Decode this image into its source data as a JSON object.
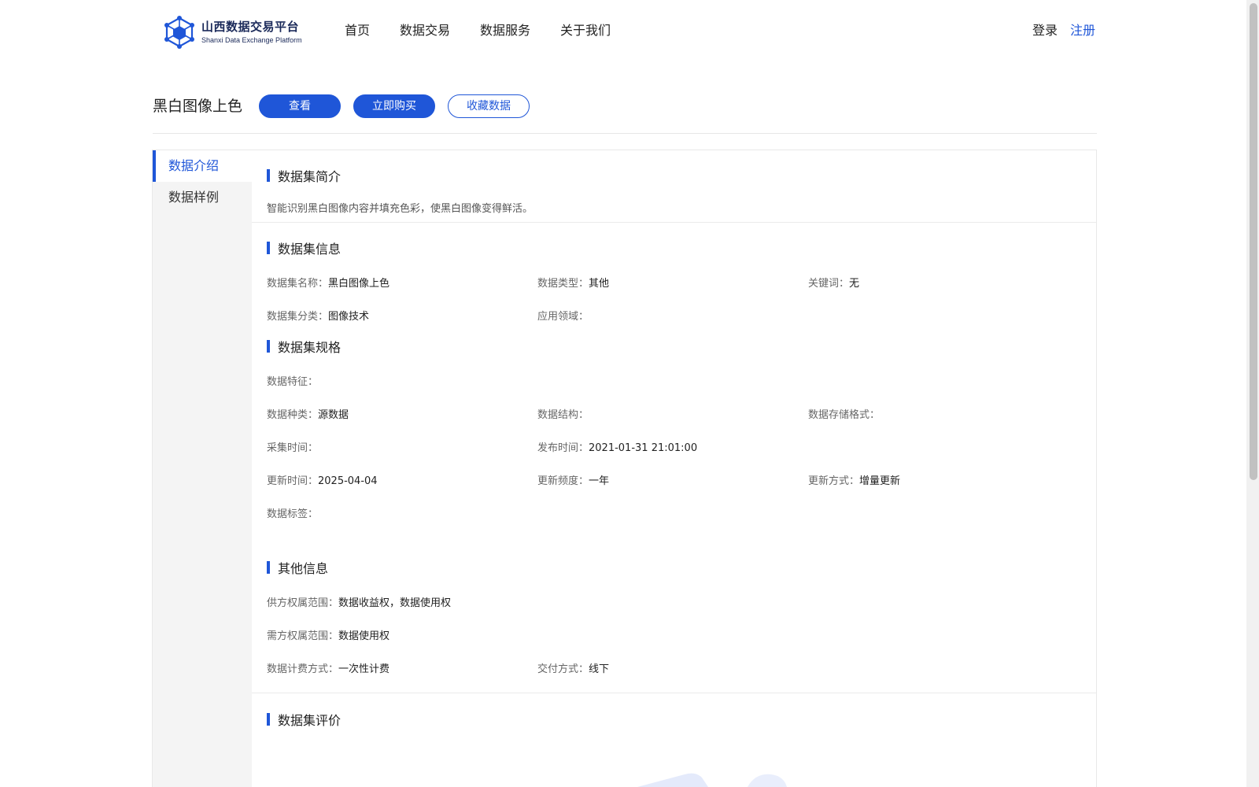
{
  "header": {
    "logo_cn": "山西数据交易平台",
    "logo_en": "Shanxi Data Exchange Platform",
    "nav": [
      "首页",
      "数据交易",
      "数据服务",
      "关于我们"
    ],
    "login": "登录",
    "register": "注册"
  },
  "title_bar": {
    "title": "黑白图像上色",
    "view_button": "查看",
    "buy_button": "立即购买",
    "favorite_button": "收藏数据"
  },
  "sidebar": {
    "items": [
      "数据介绍",
      "数据样例"
    ]
  },
  "intro": {
    "title": "数据集简介",
    "text": "智能识别黑白图像内容并填充色彩，使黑白图像变得鲜活。"
  },
  "info": {
    "title": "数据集信息",
    "name_label": "数据集名称：",
    "name": "黑白图像上色",
    "type_label": "数据类型：",
    "type": "其他",
    "keywords_label": "关键词：",
    "keywords": "无",
    "category_label": "数据集分类：",
    "category": "图像技术",
    "domain_label": "应用领域：",
    "domain": ""
  },
  "spec": {
    "title": "数据集规格",
    "feature_label": "数据特征：",
    "feature": "",
    "kind_label": "数据种类：",
    "kind": "源数据",
    "structure_label": "数据结构：",
    "structure": "",
    "storage_label": "数据存储格式：",
    "storage": "",
    "collect_label": "采集时间：",
    "collect": "",
    "publish_label": "发布时间：",
    "publish": "2021-01-31 21:01:00",
    "update_time_label": "更新时间：",
    "update_time": "2025-04-04",
    "update_freq_label": "更新频度：",
    "update_freq": "一年",
    "update_mode_label": "更新方式：",
    "update_mode": "增量更新",
    "tags_label": "数据标签：",
    "tags": ""
  },
  "other": {
    "title": "其他信息",
    "supply_label": "供方权属范围：",
    "supply": "数据收益权，数据使用权",
    "demand_label": "需方权属范围：",
    "demand": "数据使用权",
    "billing_label": "数据计费方式：",
    "billing": "一次性计费",
    "delivery_label": "交付方式：",
    "delivery": "线下"
  },
  "review": {
    "title": "数据集评价"
  },
  "colors": {
    "primary": "#1f56d8",
    "sidebar_bg": "#f4f4f4"
  }
}
